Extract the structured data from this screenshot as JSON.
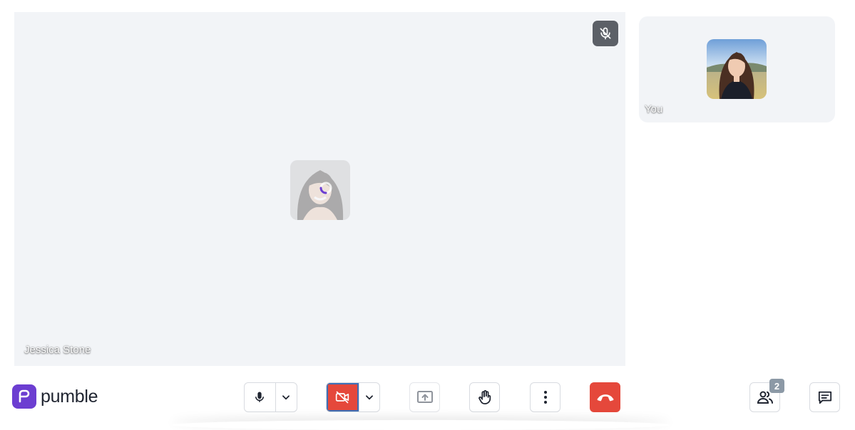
{
  "meeting": {
    "main_participant": {
      "name": "Jessica Stone",
      "muted": true,
      "video": "off",
      "avatar": "woman-portrait-dark-hair"
    },
    "self_participant": {
      "label": "You",
      "avatar": "woman-portrait-field-background"
    }
  },
  "brand": {
    "name": "pumble",
    "color": "#6c3ed1"
  },
  "toolbar": {
    "mic": {
      "icon": "microphone-icon",
      "menu_icon": "chevron-down-icon"
    },
    "camera": {
      "icon": "video-off-icon",
      "menu_icon": "chevron-down-icon",
      "state": "off",
      "color": "#e5483b"
    },
    "share_screen": {
      "icon": "screen-share-icon",
      "disabled": true
    },
    "raise_hand": {
      "icon": "hand-icon"
    },
    "more": {
      "icon": "more-vertical-icon"
    },
    "end_call": {
      "icon": "phone-hangup-icon",
      "color": "#e5483b"
    },
    "participants": {
      "icon": "participants-icon",
      "count": "2"
    },
    "chat": {
      "icon": "chat-icon"
    }
  }
}
